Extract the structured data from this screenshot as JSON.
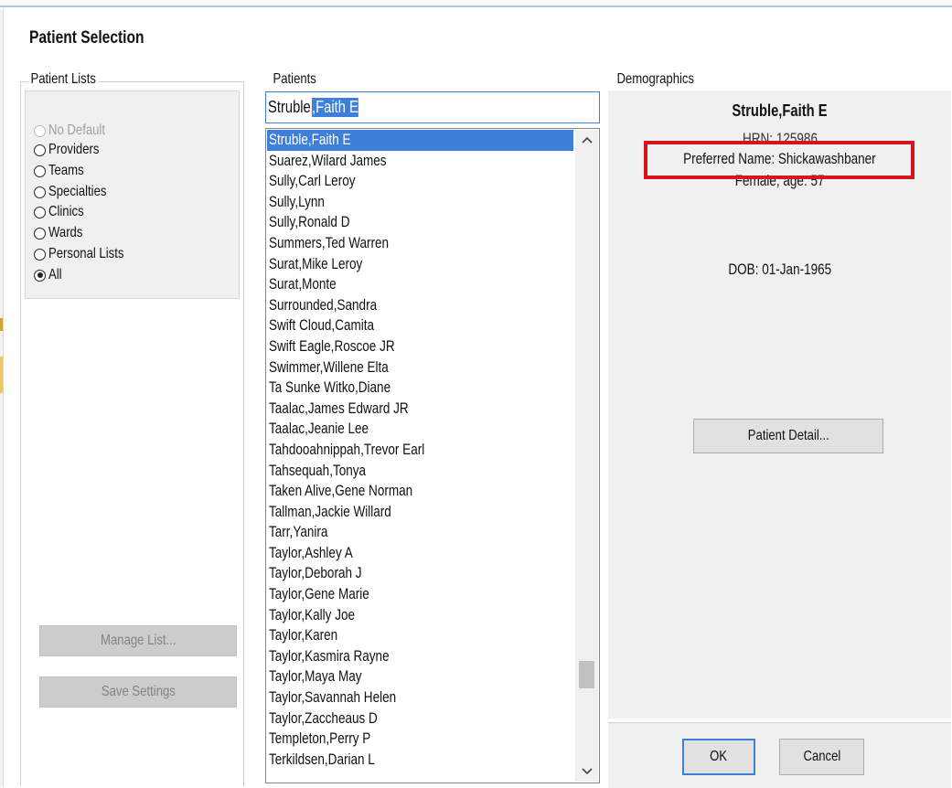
{
  "dialog": {
    "title": "Patient Selection"
  },
  "patient_lists": {
    "label": "Patient Lists",
    "options": [
      {
        "label": "No Default",
        "state": "disabled"
      },
      {
        "label": "Providers",
        "state": "normal"
      },
      {
        "label": "Teams",
        "state": "normal"
      },
      {
        "label": "Specialties",
        "state": "normal"
      },
      {
        "label": "Clinics",
        "state": "normal"
      },
      {
        "label": "Wards",
        "state": "normal"
      },
      {
        "label": "Personal Lists",
        "state": "normal"
      },
      {
        "label": "All",
        "state": "checked"
      }
    ],
    "manage_list_label": "Manage List...",
    "save_settings_label": "Save Settings"
  },
  "patients": {
    "label": "Patients",
    "search_typed": "Struble",
    "search_autocomplete": ",Faith E",
    "selected_index": 0,
    "items": [
      "Struble,Faith E",
      "Suarez,Wilard James",
      "Sully,Carl Leroy",
      "Sully,Lynn",
      "Sully,Ronald D",
      "Summers,Ted Warren",
      "Surat,Mike Leroy",
      "Surat,Monte",
      "Surrounded,Sandra",
      "Swift Cloud,Camita",
      "Swift Eagle,Roscoe JR",
      "Swimmer,Willene Elta",
      "Ta Sunke Witko,Diane",
      "Taalac,James Edward JR",
      "Taalac,Jeanie Lee",
      "Tahdooahnippah,Trevor Earl",
      "Tahsequah,Tonya",
      "Taken Alive,Gene Norman",
      "Tallman,Jackie Willard",
      "Tarr,Yanira",
      "Taylor,Ashley A",
      "Taylor,Deborah J",
      "Taylor,Gene Marie",
      "Taylor,Kally Joe",
      "Taylor,Karen",
      "Taylor,Kasmira Rayne",
      "Taylor,Maya May",
      "Taylor,Savannah Helen",
      "Taylor,Zaccheaus D",
      "Templeton,Perry P",
      "Terkildsen,Darian L"
    ]
  },
  "demographics": {
    "label": "Demographics",
    "name": "Struble,Faith E",
    "hrn": "HRN: 125986",
    "preferred_name": "Preferred Name: Shickawashbaner",
    "sex_age": "Female, age: 57",
    "dob": "DOB: 01-Jan-1965",
    "detail_button_label": "Patient Detail..."
  },
  "actions": {
    "ok_label": "OK",
    "cancel_label": "Cancel"
  },
  "colors": {
    "selection": "#3d7fd9",
    "highlight_box": "#d4151e",
    "panel": "#f0f0f0"
  },
  "icons": {
    "scroll_up": "chevron-up-icon",
    "scroll_down": "chevron-down-icon"
  }
}
